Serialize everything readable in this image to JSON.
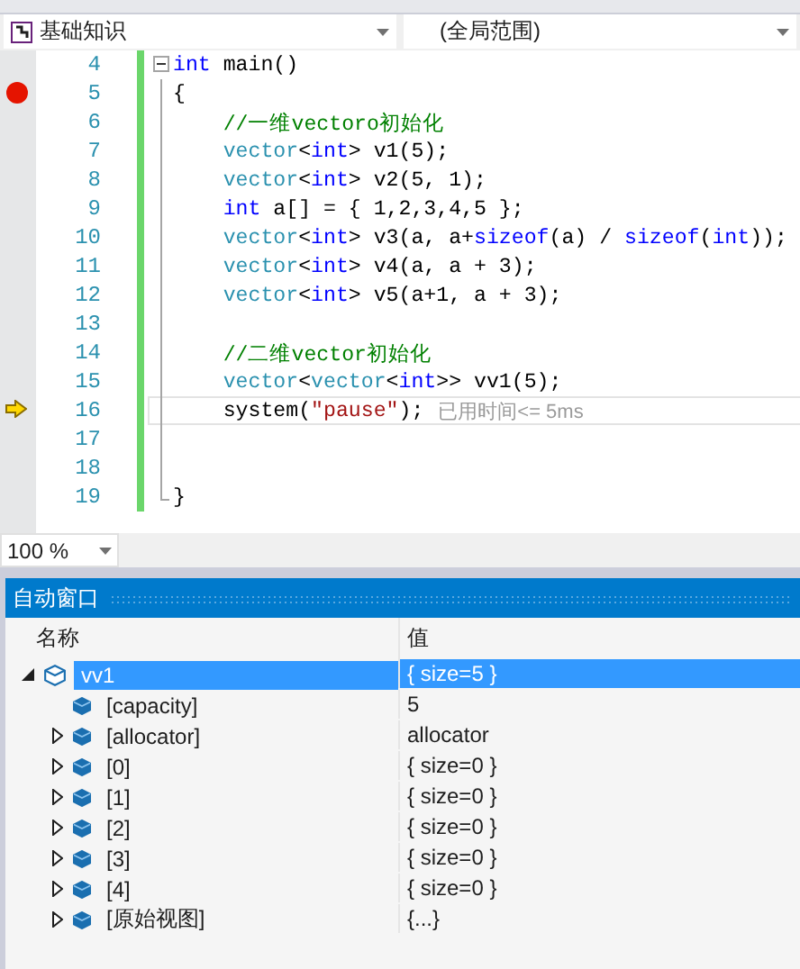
{
  "nav": {
    "project": "基础知识",
    "scope": "(全局范围)"
  },
  "lines": [
    {
      "number": "4",
      "breakpoint": false,
      "current": false,
      "tokens": [
        {
          "kind": "keyword",
          "text": "int"
        },
        {
          "kind": "plain",
          "text": " main()"
        }
      ]
    },
    {
      "number": "5",
      "breakpoint": true,
      "current": false,
      "tokens": [
        {
          "kind": "plain",
          "text": "{"
        }
      ]
    },
    {
      "number": "6",
      "breakpoint": false,
      "current": false,
      "tokens": [
        {
          "kind": "comment",
          "text": "    //一维vectoro初始化"
        }
      ]
    },
    {
      "number": "7",
      "breakpoint": false,
      "current": false,
      "tokens": [
        {
          "kind": "type",
          "text": "    vector"
        },
        {
          "kind": "plain",
          "text": "<"
        },
        {
          "kind": "keyword",
          "text": "int"
        },
        {
          "kind": "plain",
          "text": "> v1(5);"
        }
      ]
    },
    {
      "number": "8",
      "breakpoint": false,
      "current": false,
      "tokens": [
        {
          "kind": "type",
          "text": "    vector"
        },
        {
          "kind": "plain",
          "text": "<"
        },
        {
          "kind": "keyword",
          "text": "int"
        },
        {
          "kind": "plain",
          "text": "> v2(5, 1);"
        }
      ]
    },
    {
      "number": "9",
      "breakpoint": false,
      "current": false,
      "tokens": [
        {
          "kind": "keyword",
          "text": "    int"
        },
        {
          "kind": "plain",
          "text": " a[] = { 1,2,3,4,5 };"
        }
      ]
    },
    {
      "number": "10",
      "breakpoint": false,
      "current": false,
      "tokens": [
        {
          "kind": "type",
          "text": "    vector"
        },
        {
          "kind": "plain",
          "text": "<"
        },
        {
          "kind": "keyword",
          "text": "int"
        },
        {
          "kind": "plain",
          "text": "> v3(a, a+"
        },
        {
          "kind": "keyword",
          "text": "sizeof"
        },
        {
          "kind": "plain",
          "text": "(a) / "
        },
        {
          "kind": "keyword",
          "text": "sizeof"
        },
        {
          "kind": "plain",
          "text": "("
        },
        {
          "kind": "keyword",
          "text": "int"
        },
        {
          "kind": "plain",
          "text": "));"
        }
      ]
    },
    {
      "number": "11",
      "breakpoint": false,
      "current": false,
      "tokens": [
        {
          "kind": "type",
          "text": "    vector"
        },
        {
          "kind": "plain",
          "text": "<"
        },
        {
          "kind": "keyword",
          "text": "int"
        },
        {
          "kind": "plain",
          "text": "> v4(a, a + 3);"
        }
      ]
    },
    {
      "number": "12",
      "breakpoint": false,
      "current": false,
      "tokens": [
        {
          "kind": "type",
          "text": "    vector"
        },
        {
          "kind": "plain",
          "text": "<"
        },
        {
          "kind": "keyword",
          "text": "int"
        },
        {
          "kind": "plain",
          "text": "> v5(a+1, a + 3);"
        }
      ]
    },
    {
      "number": "13",
      "breakpoint": false,
      "current": false
    },
    {
      "number": "14",
      "breakpoint": false,
      "current": false,
      "tokens": [
        {
          "kind": "comment",
          "text": "    //二维vector初始化"
        }
      ]
    },
    {
      "number": "15",
      "breakpoint": false,
      "current": false,
      "tokens": [
        {
          "kind": "type",
          "text": "    vector"
        },
        {
          "kind": "plain",
          "text": "<"
        },
        {
          "kind": "type",
          "text": "vector"
        },
        {
          "kind": "plain",
          "text": "<"
        },
        {
          "kind": "keyword",
          "text": "int"
        },
        {
          "kind": "plain",
          "text": ">> vv1(5);"
        }
      ]
    },
    {
      "number": "16",
      "breakpoint": false,
      "current": true,
      "tokens": [
        {
          "kind": "plain",
          "text": "    system("
        },
        {
          "kind": "string",
          "text": "\"pause\""
        },
        {
          "kind": "plain",
          "text": ");"
        }
      ],
      "hint": "已用时间<= 5ms"
    },
    {
      "number": "17",
      "breakpoint": false,
      "current": false
    },
    {
      "number": "18",
      "breakpoint": false,
      "current": false
    },
    {
      "number": "19",
      "breakpoint": false,
      "current": false,
      "tokens": [
        {
          "kind": "plain",
          "text": "}"
        }
      ]
    }
  ],
  "zoom": "100 %",
  "watch": {
    "title": "自动窗口",
    "columns": [
      "名称",
      "值"
    ],
    "rows": [
      {
        "name": "vv1",
        "value": "{ size=5 }",
        "selected": true,
        "expandable": true,
        "expanded": true,
        "children": [
          {
            "name": "[capacity]",
            "value": "5",
            "selected": false,
            "expandable": false,
            "expanded": false
          },
          {
            "name": "[allocator]",
            "value": "allocator",
            "selected": false,
            "expandable": true,
            "expanded": false
          },
          {
            "name": "[0]",
            "value": "{ size=0 }",
            "selected": false,
            "expandable": true,
            "expanded": false
          },
          {
            "name": "[1]",
            "value": "{ size=0 }",
            "selected": false,
            "expandable": true,
            "expanded": false
          },
          {
            "name": "[2]",
            "value": "{ size=0 }",
            "selected": false,
            "expandable": true,
            "expanded": false
          },
          {
            "name": "[3]",
            "value": "{ size=0 }",
            "selected": false,
            "expandable": true,
            "expanded": false
          },
          {
            "name": "[4]",
            "value": "{ size=0 }",
            "selected": false,
            "expandable": true,
            "expanded": false
          },
          {
            "name": "[原始视图]",
            "value": "{...}",
            "selected": false,
            "expandable": true,
            "expanded": false
          }
        ]
      }
    ]
  }
}
